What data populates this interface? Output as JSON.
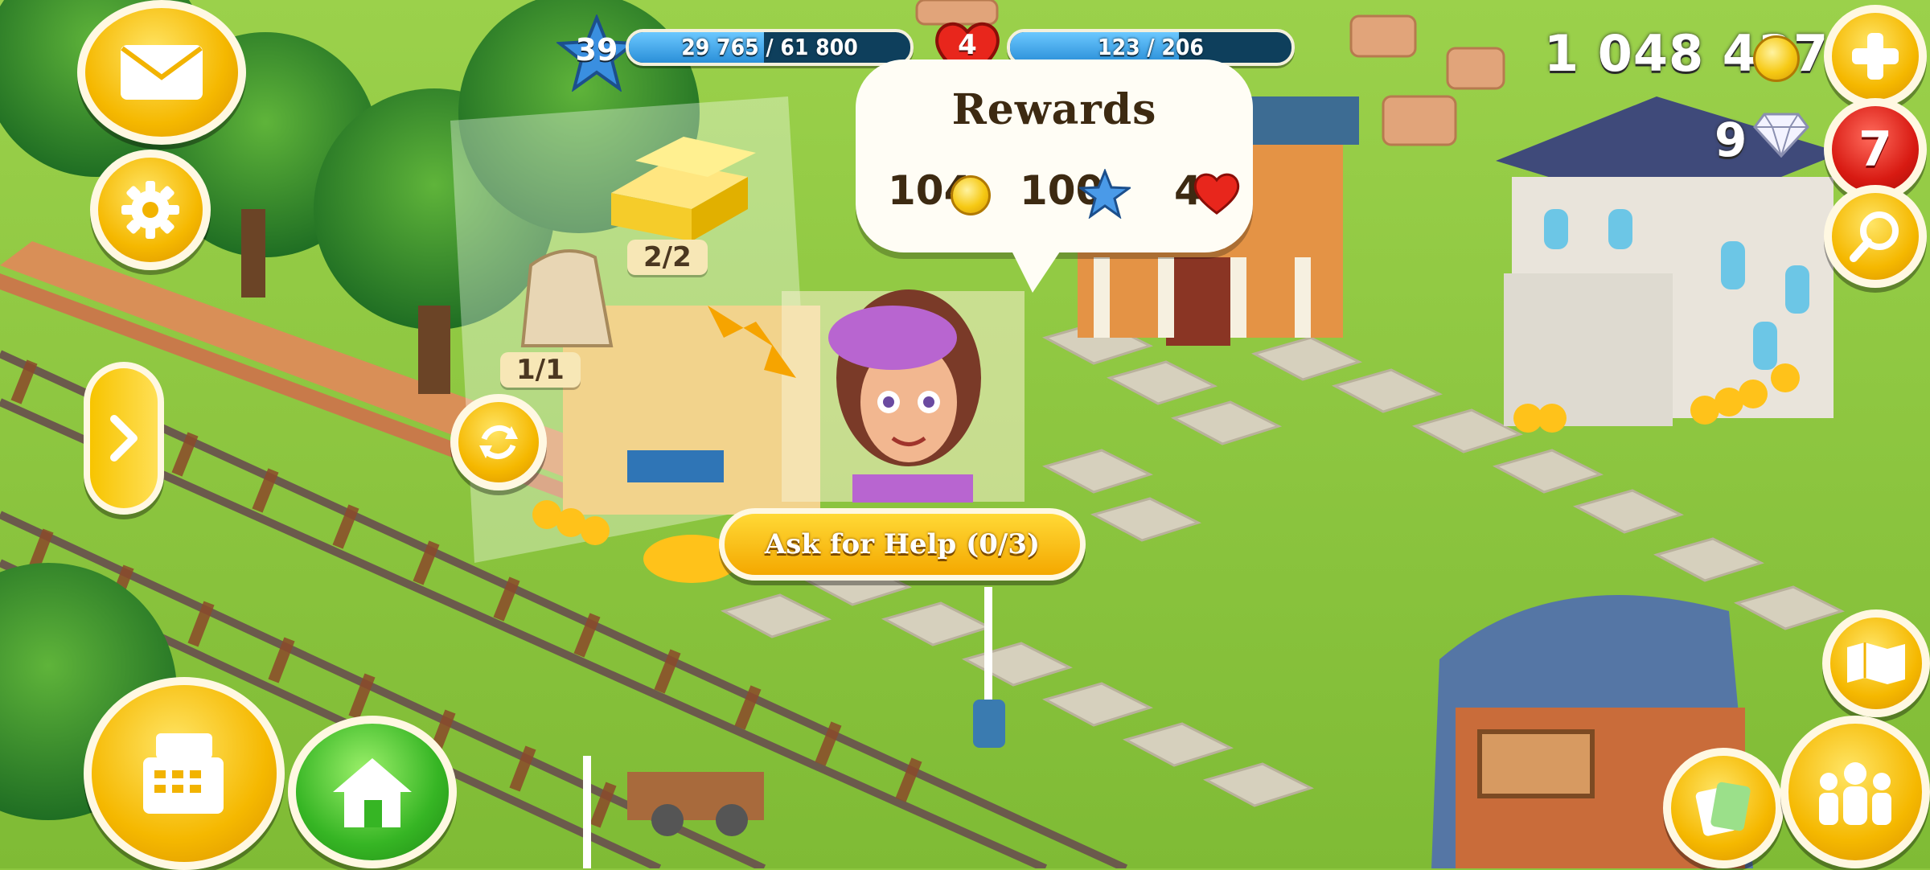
{
  "hud": {
    "level": "39",
    "xp_text": "29 765 / 61 800",
    "xp_progress": 0.48,
    "town_level": "4",
    "town_xp_text": "123 / 206",
    "town_xp_progress": 0.6,
    "coins": "1 048 437",
    "gems": "9",
    "notifications": "7"
  },
  "rewards_popup": {
    "title": "Rewards",
    "coins": "104",
    "xp": "100",
    "reputation": "4"
  },
  "order": {
    "item1_count": "2/2",
    "item2_count": "1/1",
    "help_button": "Ask for Help (0/3)"
  },
  "icons": {
    "mail": "envelope-icon",
    "settings": "gear-icon",
    "add": "plus-icon",
    "search": "magnifier-icon",
    "expand": "arrow-right-icon",
    "shop": "cash-register-icon",
    "home": "house-icon",
    "map": "map-icon",
    "townsfolk": "people-icon",
    "cards": "cards-icon",
    "refresh": "refresh-icon"
  },
  "colors": {
    "grass": "#8cc63f",
    "button_yellow": "#f5b800",
    "button_green": "#36b524",
    "badge_red": "#d81a12",
    "xp_blue": "#2a8fd8"
  }
}
